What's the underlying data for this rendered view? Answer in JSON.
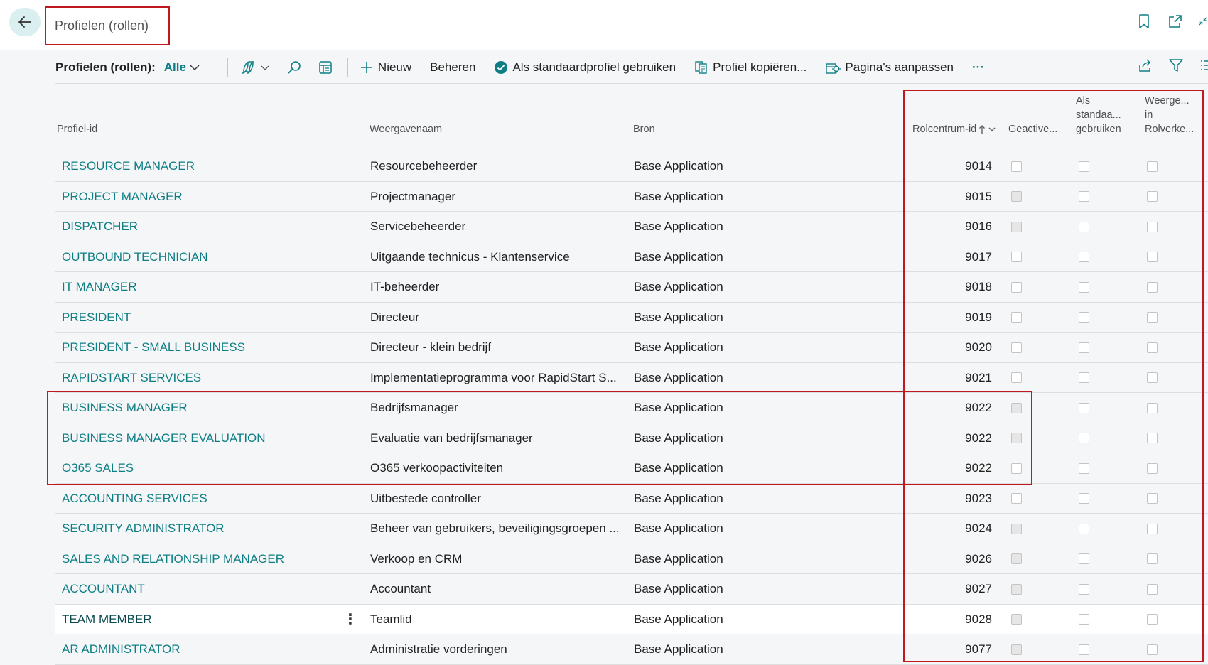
{
  "header": {
    "title": "Profielen (rollen)"
  },
  "actionbar": {
    "label": "Profielen (rollen):",
    "filter_value": "Alle",
    "new_label": "Nieuw",
    "manage_label": "Beheren",
    "default_label": "Als standaardprofiel gebruiken",
    "copy_label": "Profiel kopiëren...",
    "customize_label": "Pagina's aanpassen",
    "more_label": "···"
  },
  "columns": {
    "profile_id": "Profiel-id",
    "display_name": "Weergavenaam",
    "source": "Bron",
    "rolecenter_id": "Rolcentrum-id",
    "disabled": "Geactive...",
    "default_l1": "Als",
    "default_l2": "standaa...",
    "default_l3": "gebruiken",
    "shown_l1": "Weerge...",
    "shown_l2": "in",
    "shown_l3": "Rolverke..."
  },
  "rows": [
    {
      "id": "RESOURCE MANAGER",
      "name": "Resourcebeheerder",
      "source": "Base Application",
      "rc": "9014",
      "disabled": false,
      "default": false,
      "shown": false
    },
    {
      "id": "PROJECT MANAGER",
      "name": "Projectmanager",
      "source": "Base Application",
      "rc": "9015",
      "disabled": true,
      "default": false,
      "shown": false
    },
    {
      "id": "DISPATCHER",
      "name": "Servicebeheerder",
      "source": "Base Application",
      "rc": "9016",
      "disabled": true,
      "default": false,
      "shown": false
    },
    {
      "id": "OUTBOUND TECHNICIAN",
      "name": "Uitgaande technicus - Klantenservice",
      "source": "Base Application",
      "rc": "9017",
      "disabled": false,
      "default": false,
      "shown": false
    },
    {
      "id": "IT MANAGER",
      "name": "IT-beheerder",
      "source": "Base Application",
      "rc": "9018",
      "disabled": false,
      "default": false,
      "shown": false
    },
    {
      "id": "PRESIDENT",
      "name": "Directeur",
      "source": "Base Application",
      "rc": "9019",
      "disabled": false,
      "default": false,
      "shown": false
    },
    {
      "id": "PRESIDENT - SMALL BUSINESS",
      "name": "Directeur - klein bedrijf",
      "source": "Base Application",
      "rc": "9020",
      "disabled": false,
      "default": false,
      "shown": false
    },
    {
      "id": "RAPIDSTART SERVICES",
      "name": "Implementatieprogramma voor RapidStart S...",
      "source": "Base Application",
      "rc": "9021",
      "disabled": false,
      "default": false,
      "shown": false
    },
    {
      "id": "BUSINESS MANAGER",
      "name": "Bedrijfsmanager",
      "source": "Base Application",
      "rc": "9022",
      "disabled": true,
      "default": false,
      "shown": false
    },
    {
      "id": "BUSINESS MANAGER EVALUATION",
      "name": "Evaluatie van bedrijfsmanager",
      "source": "Base Application",
      "rc": "9022",
      "disabled": true,
      "default": false,
      "shown": false
    },
    {
      "id": "O365 SALES",
      "name": "O365 verkoopactiviteiten",
      "source": "Base Application",
      "rc": "9022",
      "disabled": false,
      "default": false,
      "shown": false
    },
    {
      "id": "ACCOUNTING SERVICES",
      "name": "Uitbestede controller",
      "source": "Base Application",
      "rc": "9023",
      "disabled": false,
      "default": false,
      "shown": false
    },
    {
      "id": "SECURITY ADMINISTRATOR",
      "name": "Beheer van gebruikers, beveiligingsgroepen ...",
      "source": "Base Application",
      "rc": "9024",
      "disabled": true,
      "default": false,
      "shown": false
    },
    {
      "id": "SALES AND RELATIONSHIP MANAGER",
      "name": "Verkoop en CRM",
      "source": "Base Application",
      "rc": "9026",
      "disabled": true,
      "default": false,
      "shown": false
    },
    {
      "id": "ACCOUNTANT",
      "name": "Accountant",
      "source": "Base Application",
      "rc": "9027",
      "disabled": true,
      "default": false,
      "shown": false
    },
    {
      "id": "TEAM MEMBER",
      "name": "Teamlid",
      "source": "Base Application",
      "rc": "9028",
      "disabled": true,
      "default": false,
      "shown": false,
      "selected": true
    },
    {
      "id": "AR ADMINISTRATOR",
      "name": "Administratie vorderingen",
      "source": "Base Application",
      "rc": "9077",
      "disabled": true,
      "default": false,
      "shown": false
    }
  ]
}
